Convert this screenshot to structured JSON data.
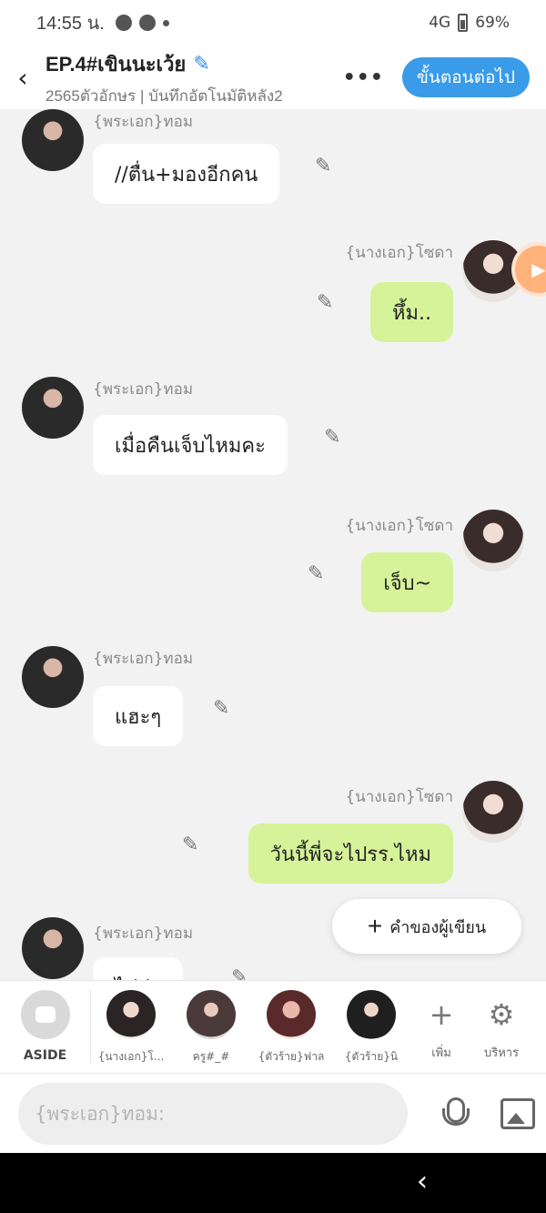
{
  "status_bar": {
    "time": "14:55 น.",
    "network": "4G",
    "battery": "69%"
  },
  "header": {
    "title": "EP.4#เขินนะเว้ย",
    "subtitle": "2565ตัวอักษร | บันทึกอัตโนมัติหลัง2",
    "more": "•••",
    "next_button": "ขั้นตอนต่อไป"
  },
  "messages": [
    {
      "speaker": "{พระเอก}ทอม",
      "text": "//ตื่น+มองอีกคน",
      "side": "left"
    },
    {
      "speaker": "{นางเอก}โซดา",
      "text": "หึ้ม..",
      "side": "right"
    },
    {
      "speaker": "{พระเอก}ทอม",
      "text": "เมื่อคืนเจ็บไหมคะ",
      "side": "left"
    },
    {
      "speaker": "{นางเอก}โซดา",
      "text": "เจ็บ~",
      "side": "right"
    },
    {
      "speaker": "{พระเอก}ทอม",
      "text": "แฮะๆ",
      "side": "left"
    },
    {
      "speaker": "{นางเอก}โซดา",
      "text": "วันนี้พี่จะไปรร.ไหม",
      "side": "right"
    },
    {
      "speaker": "{พระเอก}ทอม",
      "text": "ไม่ล่ะ",
      "side": "left"
    }
  ],
  "author_note_button": "คำของผู้เขียน",
  "character_bar": {
    "aside_label": "ASIDE",
    "characters": [
      "{นางเอก}โ...",
      "ครู#_#",
      "{ตัวร้าย}ฟาล",
      "{ตัวร้าย}นิ"
    ],
    "add_label": "เพิ่ม",
    "manage_label": "บริหาร"
  },
  "input": {
    "placeholder": "{พระเอก}ทอม:"
  },
  "icons": [
    "back-arrow-icon",
    "pencil-icon",
    "camera-icon",
    "plus-icon",
    "gear-icon",
    "mic-icon",
    "image-icon"
  ],
  "colors": {
    "accent": "#3a9be8",
    "right_bubble": "#d6f39a",
    "left_bubble": "#ffffff"
  }
}
